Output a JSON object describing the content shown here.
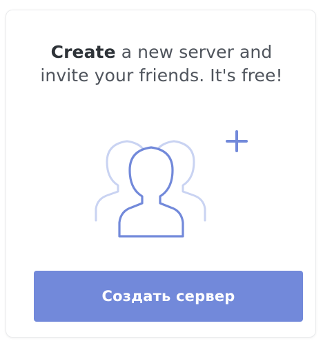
{
  "card": {
    "headline_strong": "Create",
    "headline_line1_rest": " a new server and",
    "headline_line2": "invite your friends. It's free!"
  },
  "illustration": {
    "icon": "group-add-icon",
    "plus_glyph": "+"
  },
  "create_button": {
    "label": "Создать сервер"
  },
  "colors": {
    "accent": "#7289da",
    "text_strong": "#2e3338",
    "text_body": "#4f545c",
    "icon_back": "#c9d3f2",
    "icon_front": "#7289da"
  }
}
